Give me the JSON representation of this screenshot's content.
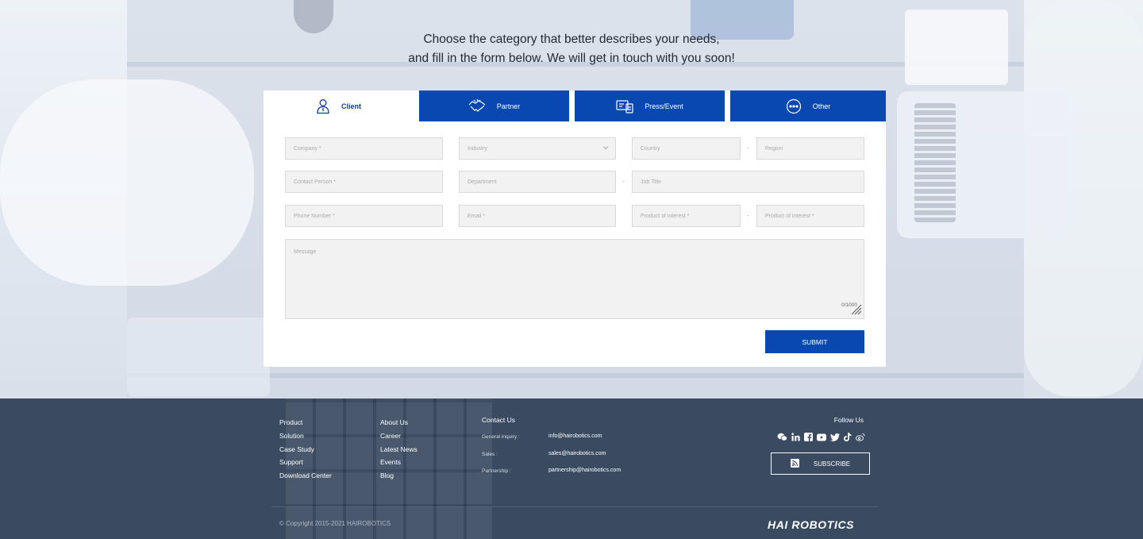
{
  "intro": {
    "line1": "Choose the category that better describes your needs,",
    "line2": "and fill in the form below. We will get in touch with you soon!"
  },
  "tabs": [
    {
      "label": "Client",
      "icon": "person-icon",
      "active": true
    },
    {
      "label": "Partner",
      "icon": "handshake-icon",
      "active": false
    },
    {
      "label": "Press/Event",
      "icon": "press-event-icon",
      "active": false
    },
    {
      "label": "Other",
      "icon": "more-icon",
      "active": false
    }
  ],
  "form": {
    "company": "Company *",
    "industry": "Industry",
    "country": "Country",
    "region": "Region",
    "contact_person": "Contact Person *",
    "department": "Department",
    "job_title": "Job Title",
    "phone": "Phone Number *",
    "email": "Email *",
    "product_interest_1": "Product of interest *",
    "product_interest_2": "Product of interest *",
    "message": "Message",
    "counter": "0/1000",
    "separator": "-",
    "submit": "SUBMIT"
  },
  "footer": {
    "col1": [
      "Product",
      "Solution",
      "Case Study",
      "Support",
      "Download Center"
    ],
    "col2": [
      "About Us",
      "Career",
      "Latest News",
      "Events",
      "Blog"
    ],
    "contact": {
      "title": "Contact Us",
      "rows": [
        {
          "label": "General inquiry :",
          "value": "info@hairobotics.com"
        },
        {
          "label": "Sales :",
          "value": "sales@hairobotics.com"
        },
        {
          "label": "Partnership :",
          "value": "partnership@hairobotics.com"
        }
      ]
    },
    "follow": "Follow Us",
    "social_icons": [
      "wechat-icon",
      "linkedin-icon",
      "facebook-icon",
      "youtube-icon",
      "twitter-icon",
      "tiktok-icon",
      "weibo-icon"
    ],
    "subscribe": "SUBSCRIBE",
    "copyright": "© Copyright 2015-2021 HAIROBOTICS",
    "brand": "HAI ROBOTICS"
  },
  "colors": {
    "accent": "#0948b0",
    "footer_bg": "#3a4a61"
  }
}
